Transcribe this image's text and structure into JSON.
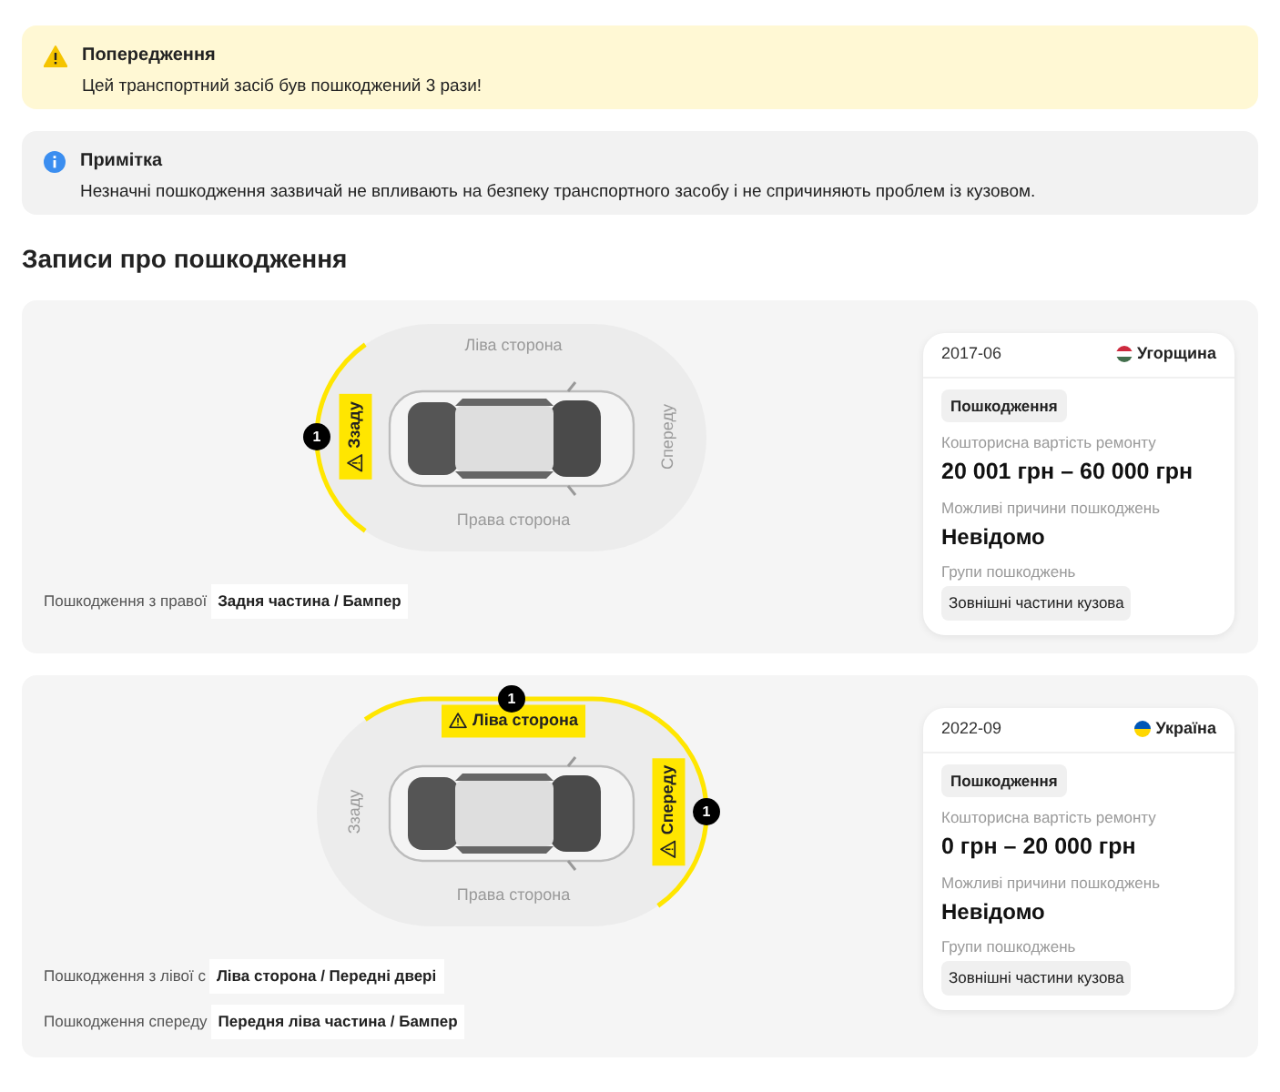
{
  "alerts": [
    {
      "kind": "warning",
      "title": "Попередження",
      "text": "Цей транспортний засіб був пошкоджений 3 рази!"
    },
    {
      "kind": "info",
      "title": "Примітка",
      "text": "Незначні пошкодження зазвичай не впливають на безпеку транспортного засобу і не спричиняють проблем із кузовом."
    }
  ],
  "heading": "Записи про пошкодження",
  "records": [
    {
      "sides": [
        {
          "kind": "top",
          "label": "Ліва сторона",
          "damaged": false
        },
        {
          "kind": "bottom",
          "label": "Права сторона",
          "damaged": false
        },
        {
          "kind": "left",
          "label": "Ззаду",
          "damaged": true,
          "count": "1"
        },
        {
          "kind": "right",
          "label": "Спереду",
          "damaged": false
        }
      ],
      "damages": [
        {
          "label": "Пошкодження з правої",
          "value": "Задня частина / Бампер"
        }
      ],
      "card": {
        "date": "2017-06",
        "flag": {
          "kind": "hungary"
        },
        "country": "Угорщина",
        "tag": "Пошкодження",
        "cost_label": "Кошторисна вартість ремонту",
        "cost": "20 001 грн – 60 000 грн",
        "cause_label": "Можливі причини пошкоджень",
        "cause": "Невідомо",
        "groups_label": "Групи пошкоджень",
        "groups": [
          "Зовнішні частини кузова"
        ]
      }
    },
    {
      "sides": [
        {
          "kind": "top",
          "label": "Ліва сторона",
          "damaged": true,
          "count": "1"
        },
        {
          "kind": "bottom",
          "label": "Права сторона",
          "damaged": false
        },
        {
          "kind": "left",
          "label": "Ззаду",
          "damaged": false
        },
        {
          "kind": "right",
          "label": "Спереду",
          "damaged": true,
          "count": "1"
        }
      ],
      "damages": [
        {
          "label": "Пошкодження з лівої с",
          "value": "Ліва сторона / Передні двері"
        },
        {
          "label": "Пошкодження спереду",
          "value": "Передня ліва частина / Бампер"
        }
      ],
      "card": {
        "date": "2022-09",
        "flag": {
          "kind": "ukraine"
        },
        "country": "Україна",
        "tag": "Пошкодження",
        "cost_label": "Кошторисна вартість ремонту",
        "cost": "0 грн – 20 000 грн",
        "cause_label": "Можливі причини пошкоджень",
        "cause": "Невідомо",
        "groups_label": "Групи пошкоджень",
        "groups": [
          "Зовнішні частини кузова"
        ]
      }
    }
  ]
}
